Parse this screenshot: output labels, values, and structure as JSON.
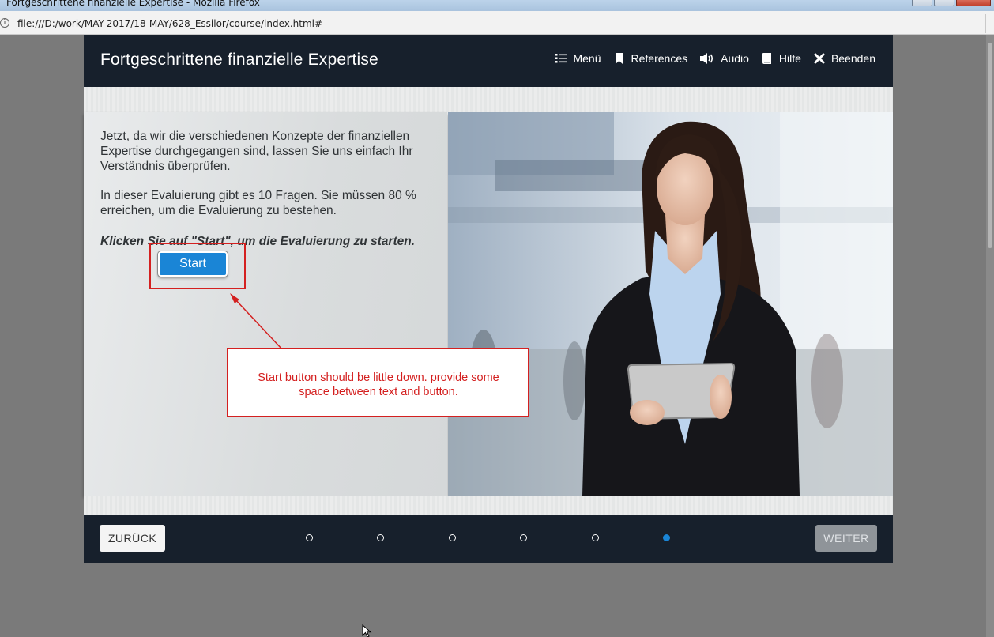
{
  "browser": {
    "window_title": "Fortgeschrittene finanzielle Expertise - Mozilla Firefox",
    "url": "file:///D:/work/MAY-2017/18-MAY/628_Essilor/course/index.html#"
  },
  "course": {
    "title": "Fortgeschrittene finanzielle Expertise",
    "nav": [
      {
        "label": "Menü",
        "icon": "list-icon"
      },
      {
        "label": "References",
        "icon": "bookmark-icon"
      },
      {
        "label": "Audio",
        "icon": "speaker-icon"
      },
      {
        "label": "Hilfe",
        "icon": "book-icon"
      },
      {
        "label": "Beenden",
        "icon": "close-icon"
      }
    ],
    "content": {
      "paragraph1": "Jetzt, da wir die verschiedenen Konzepte der finanziellen Expertise durchgegangen sind, lassen Sie uns einfach Ihr Verständnis überprüfen.",
      "paragraph2": "In dieser Evaluierung gibt es 10 Fragen. Sie müssen 80 % erreichen, um die Evaluierung zu bestehen.",
      "instruction_prefix": "Klicken Sie auf \"",
      "instruction_bold": "Start",
      "instruction_suffix": "\", um die Evaluierung zu starten.",
      "start_button": "Start"
    },
    "footer": {
      "back_label": "ZURÜCK",
      "next_label": "WEITER",
      "page_dots": 6,
      "active_dot": 6
    }
  },
  "annotation": {
    "note": "Start button should be little down. provide some space between text and button.",
    "color": "#d42020"
  },
  "colors": {
    "header_bg": "#17202c",
    "accent_blue": "#1a85d6"
  }
}
